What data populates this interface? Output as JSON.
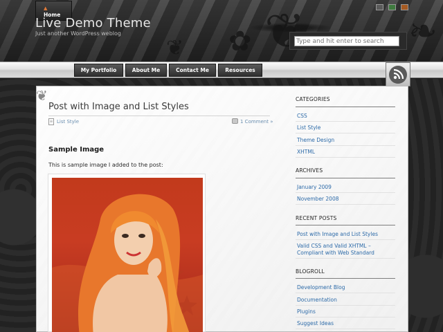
{
  "site": {
    "title": "Live Demo Theme",
    "tagline": "Just another WordPress weblog"
  },
  "style_switcher": {
    "colors": [
      "#5b5b5b",
      "#3f7a3f",
      "#a55a22"
    ]
  },
  "search": {
    "placeholder": "Type and hit enter to search"
  },
  "nav": {
    "home": "Home",
    "items": [
      "My Portfolio",
      "About Me",
      "Contact Me",
      "Resources"
    ]
  },
  "icons": {
    "home": "home-icon",
    "rss": "rss-feed-icon",
    "category": "category-page-icon",
    "comment": "comment-bubble-icon"
  },
  "post": {
    "title": "Post with Image and List Styles",
    "category": "List Style",
    "comments": "1 Comment »",
    "subheading": "Sample Image",
    "body": "This is sample image I added to the post:"
  },
  "sidebar": {
    "categories": {
      "heading": "CATEGORIES",
      "items": [
        "CSS",
        "List Style",
        "Theme Design",
        "XHTML"
      ]
    },
    "archives": {
      "heading": "ARCHIVES",
      "items": [
        "January 2009",
        "November 2008"
      ]
    },
    "recent": {
      "heading": "RECENT POSTS",
      "items": [
        "Post with Image and List Styles",
        "Valid CSS and Valid XHTML –",
        "Compliant with Web Standard"
      ]
    },
    "blogroll": {
      "heading": "BLOGROLL",
      "items": [
        "Development Blog",
        "Documentation",
        "Plugins",
        "Suggest Ideas"
      ]
    }
  },
  "colors": {
    "link": "#2c6aa8",
    "nav_bg": "#3a3a3a",
    "accent_orange": "#e07a3a"
  }
}
